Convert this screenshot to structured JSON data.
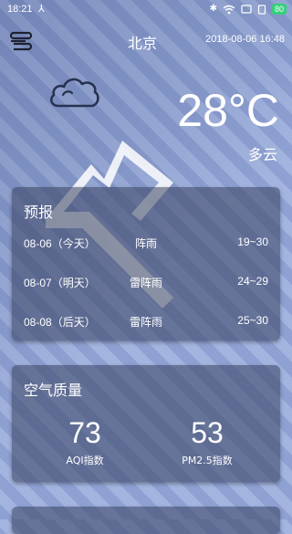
{
  "status": {
    "time": "18:21",
    "battery": "80"
  },
  "header": {
    "city": "北京",
    "datetime": "2018-08-06 16:48"
  },
  "current": {
    "temperature": "28°C",
    "condition": "多云"
  },
  "forecast": {
    "title": "预报",
    "rows": [
      {
        "date": "08-06（今天）",
        "weather": "阵雨",
        "temp": "19~30"
      },
      {
        "date": "08-07（明天）",
        "weather": "雷阵雨",
        "temp": "24~29"
      },
      {
        "date": "08-08（后天）",
        "weather": "雷阵雨",
        "temp": "25~30"
      }
    ]
  },
  "air_quality": {
    "title": "空气质量",
    "aqi_value": "73",
    "aqi_label": "AQI指数",
    "pm25_value": "53",
    "pm25_label": "PM2.5指数"
  },
  "icons": {
    "menu": "menu-icon",
    "cloud": "cloud-icon",
    "mountain": "mountain-icon",
    "bluetooth": "bluetooth-icon",
    "wifi": "wifi-icon",
    "battery": "battery-icon"
  },
  "colors": {
    "battery": "#34d17a",
    "card_bg": "#37405f"
  }
}
